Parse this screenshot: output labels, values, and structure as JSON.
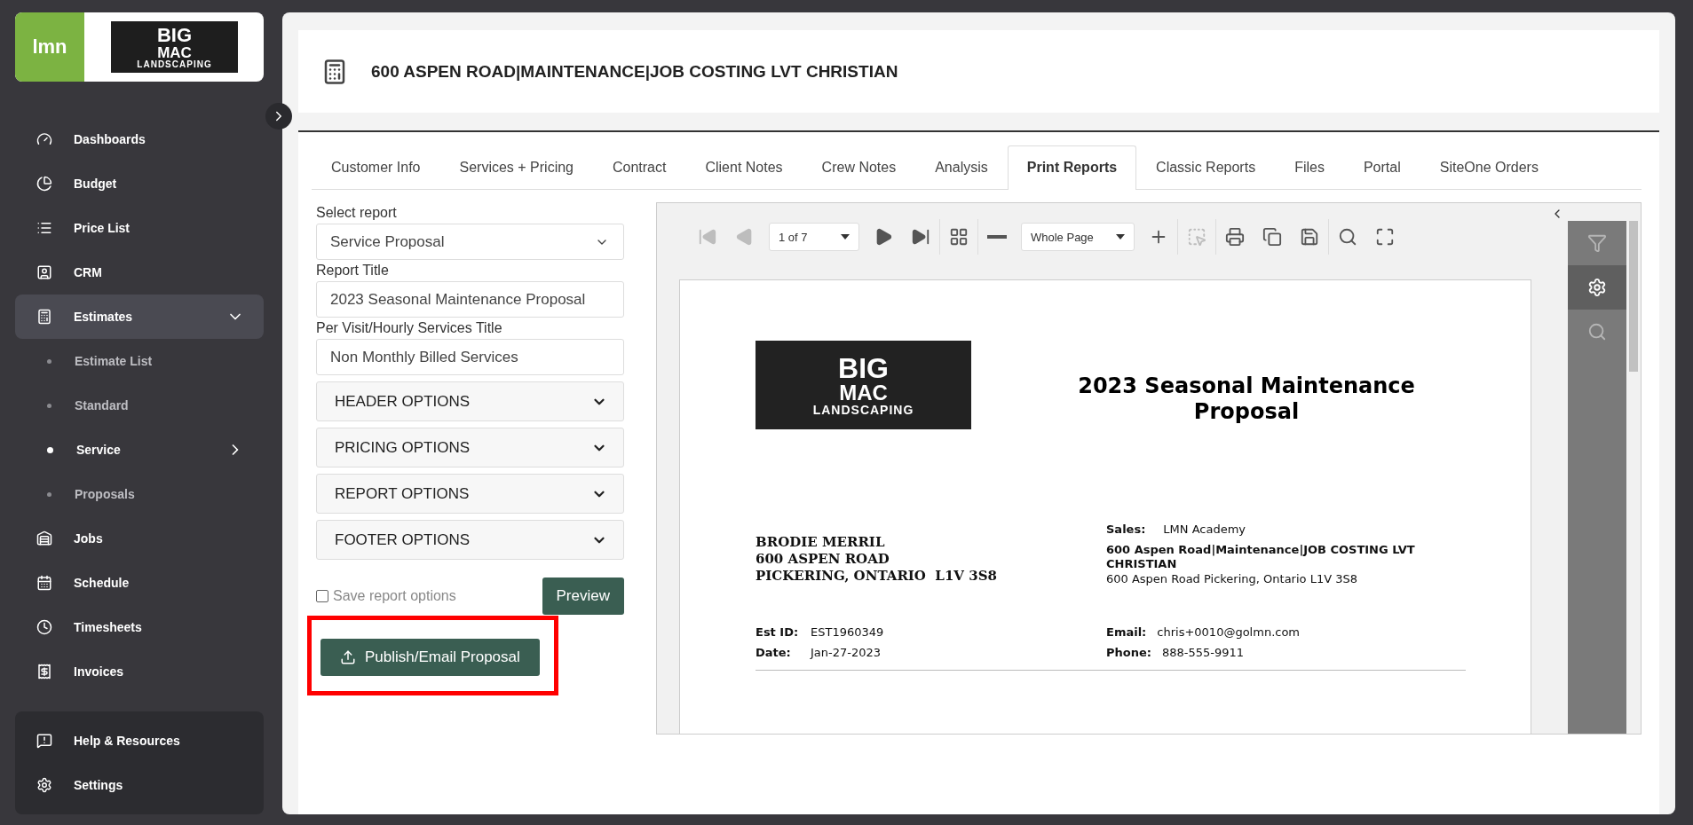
{
  "sidebar": {
    "brand": {
      "app": "lmn",
      "company_top": "BIG",
      "company_mid": "MAC",
      "company_bottom": "LANDSCAPING"
    },
    "items": [
      {
        "label": "Dashboards",
        "selected": false
      },
      {
        "label": "Budget",
        "selected": false
      },
      {
        "label": "Price List",
        "selected": false
      },
      {
        "label": "CRM",
        "selected": false
      },
      {
        "label": "Estimates",
        "selected": true,
        "expanded": true,
        "children": [
          {
            "label": "Estimate List",
            "selected": false,
            "submenu": false
          },
          {
            "label": "Standard",
            "selected": false,
            "submenu": false
          },
          {
            "label": "Service",
            "selected": true,
            "submenu": true
          },
          {
            "label": "Proposals",
            "selected": false,
            "submenu": false
          }
        ]
      },
      {
        "label": "Jobs",
        "selected": false
      },
      {
        "label": "Schedule",
        "selected": false
      },
      {
        "label": "Timesheets",
        "selected": false
      },
      {
        "label": "Invoices",
        "selected": false
      }
    ],
    "footer_items": [
      {
        "label": "Help & Resources"
      },
      {
        "label": "Settings"
      }
    ]
  },
  "header": {
    "title": "600 ASPEN ROAD|MAINTENANCE|JOB COSTING LVT CHRISTIAN"
  },
  "tabs": [
    {
      "label": "Customer Info",
      "selected": false
    },
    {
      "label": "Services + Pricing",
      "selected": false
    },
    {
      "label": "Contract",
      "selected": false
    },
    {
      "label": "Client Notes",
      "selected": false
    },
    {
      "label": "Crew Notes",
      "selected": false
    },
    {
      "label": "Analysis",
      "selected": false
    },
    {
      "label": "Print Reports",
      "selected": true
    },
    {
      "label": "Classic Reports",
      "selected": false
    },
    {
      "label": "Files",
      "selected": false
    },
    {
      "label": "Portal",
      "selected": false
    },
    {
      "label": "SiteOne Orders",
      "selected": false
    }
  ],
  "form": {
    "select_label": "Select report",
    "select_value": "Service Proposal",
    "fields": [
      {
        "label": "Report Title",
        "value": "2023 Seasonal Maintenance Proposal"
      },
      {
        "label": "Per Visit/Hourly Services Title",
        "value": "Non Monthly Billed Services"
      }
    ],
    "sections": [
      {
        "label": "HEADER OPTIONS",
        "expanded": false
      },
      {
        "label": "PRICING OPTIONS",
        "expanded": false
      },
      {
        "label": "REPORT OPTIONS",
        "expanded": false
      },
      {
        "label": "FOOTER OPTIONS",
        "expanded": false
      }
    ],
    "save_option": {
      "label": "Save report options",
      "checked": false
    },
    "preview_button": "Preview",
    "publish_button": {
      "label": "Publish/Email Proposal",
      "highlighted": true
    }
  },
  "viewer": {
    "page_select": "1 of 7",
    "zoom_select": "Whole Page",
    "toolbar": [
      {
        "kind": "first",
        "disabled": true
      },
      {
        "kind": "prev",
        "disabled": true
      },
      {
        "kind": "pageselect"
      },
      {
        "kind": "next",
        "disabled": false
      },
      {
        "kind": "last",
        "disabled": false
      },
      {
        "kind": "multipage",
        "disabled": false
      },
      {
        "kind": "zoomout",
        "disabled": false
      },
      {
        "kind": "zoomselect"
      },
      {
        "kind": "zoomin",
        "disabled": false
      },
      {
        "kind": "selecttool",
        "disabled": true
      },
      {
        "kind": "print",
        "disabled": false
      },
      {
        "kind": "printpage",
        "disabled": false
      },
      {
        "kind": "export",
        "disabled": false
      },
      {
        "kind": "search",
        "disabled": false
      },
      {
        "kind": "fullscreen",
        "disabled": false
      }
    ],
    "side_tabs": [
      {
        "kind": "filter",
        "selected": false
      },
      {
        "kind": "settings",
        "selected": true
      },
      {
        "kind": "search",
        "selected": false
      }
    ],
    "document": {
      "logo_top": "BIG",
      "logo_mid": "MAC",
      "logo_bottom": "LANDSCAPING",
      "title": "2023 Seasonal Maintenance Proposal",
      "customer": [
        "BRODIE MERRIL",
        "600 ASPEN ROAD",
        "PICKERING, ONTARIO  L1V 3S8"
      ],
      "sales_label": "Sales:",
      "sales_value": "LMN Academy",
      "job_title": "600 Aspen Road|Maintenance|JOB COSTING LVT CHRISTIAN",
      "job_address": "600 Aspen Road Pickering, Ontario L1V 3S8",
      "left_details": [
        {
          "label": "Est ID:",
          "value": "EST1960349"
        },
        {
          "label": "Date:",
          "value": "Jan-27-2023"
        }
      ],
      "right_details": [
        {
          "label": "Email:",
          "value": "chris+0010@golmn.com"
        },
        {
          "label": "Phone:",
          "value": "888-555-9911"
        }
      ]
    }
  }
}
